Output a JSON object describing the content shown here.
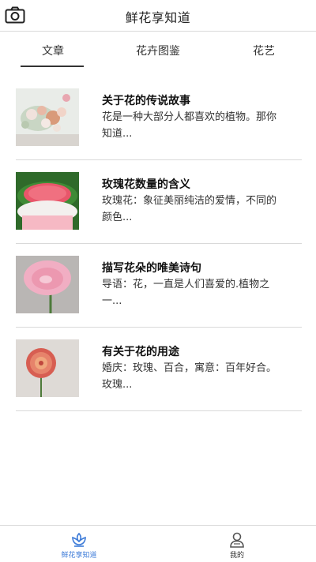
{
  "header": {
    "title": "鲜花享知道",
    "left_icon": "camera-icon"
  },
  "tabs": [
    {
      "label": "文章",
      "active": true
    },
    {
      "label": "花卉图鉴",
      "active": false
    },
    {
      "label": "花艺",
      "active": false
    }
  ],
  "articles": [
    {
      "title": "关于花的传说故事",
      "desc1": "花是一种大部分人都喜欢的植物。那你",
      "desc2": "知道..."
    },
    {
      "title": "玫瑰花数量的含义",
      "desc1": "玫瑰花：象征美丽纯洁的爱情，不同的",
      "desc2": "颜色..."
    },
    {
      "title": "描写花朵的唯美诗句",
      "desc1": "导语：花，一直是人们喜爱的.植物之",
      "desc2": "一..."
    },
    {
      "title": "有关于花的用途",
      "desc1": "婚庆：玫瑰、百合，寓意：百年好合。",
      "desc2": "玫瑰..."
    }
  ],
  "bottom_nav": [
    {
      "label": "鲜花享知道",
      "icon": "flower-icon",
      "active": true,
      "color": "#3d7bd8"
    },
    {
      "label": "我的",
      "icon": "user-icon",
      "active": false
    }
  ]
}
